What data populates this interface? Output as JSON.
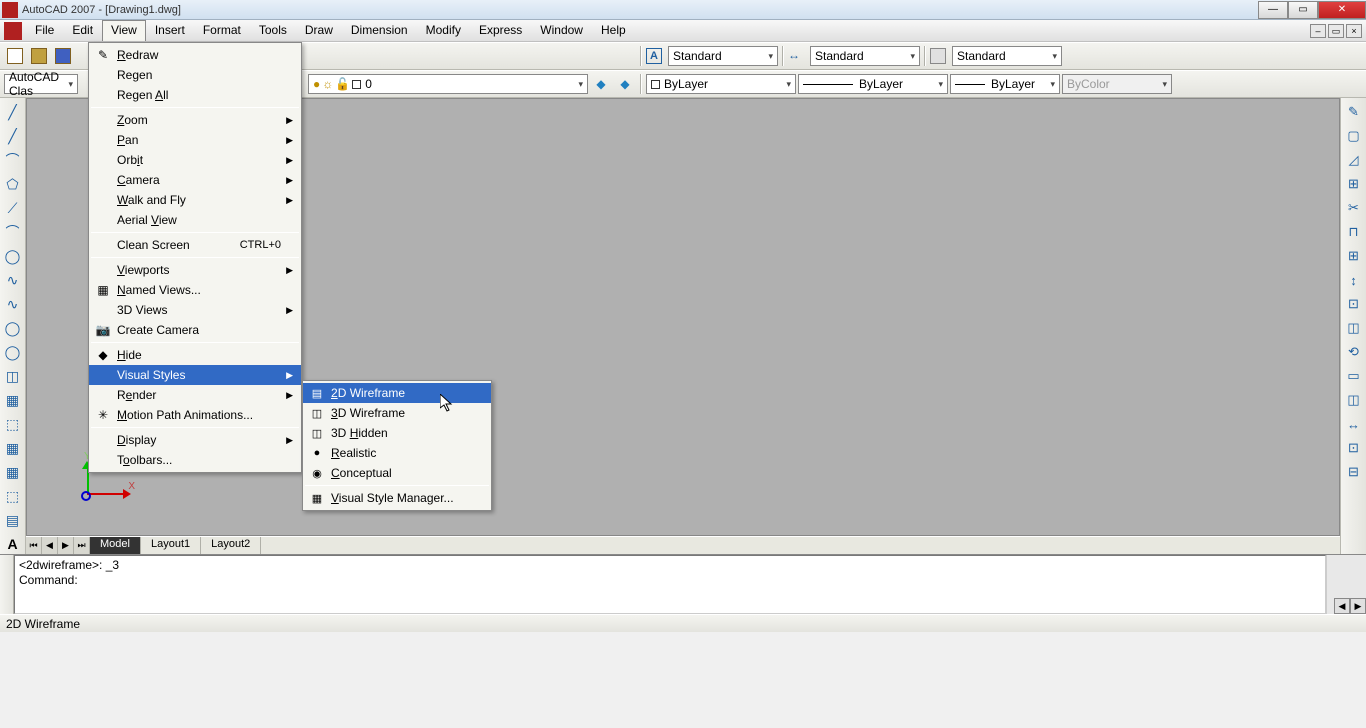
{
  "title": "AutoCAD 2007 - [Drawing1.dwg]",
  "menubar": [
    "File",
    "Edit",
    "View",
    "Insert",
    "Format",
    "Tools",
    "Draw",
    "Dimension",
    "Modify",
    "Express",
    "Window",
    "Help"
  ],
  "active_menu": "View",
  "toolbar1": {
    "workspace": "AutoCAD Clas",
    "std1": "Standard",
    "std2": "Standard",
    "std3": "Standard"
  },
  "toolbar2": {
    "layer_name": "0",
    "linetype1": "ByLayer",
    "linetype2": "ByLayer",
    "linetype3": "ByLayer",
    "color": "ByColor"
  },
  "view_menu": {
    "items": [
      {
        "label": "Redraw",
        "u": 0,
        "icon": "✎"
      },
      {
        "label": "Regen",
        "u": 2
      },
      {
        "label": "Regen All",
        "u": 6
      },
      {
        "sep": true
      },
      {
        "label": "Zoom",
        "u": 0,
        "sub": true
      },
      {
        "label": "Pan",
        "u": 0,
        "sub": true
      },
      {
        "label": "Orbit",
        "u": 3,
        "sub": true
      },
      {
        "label": "Camera",
        "u": 0,
        "sub": true
      },
      {
        "label": "Walk and Fly",
        "u": 0,
        "sub": true
      },
      {
        "label": "Aerial View",
        "u": 7
      },
      {
        "sep": true
      },
      {
        "label": "Clean Screen",
        "shortcut": "CTRL+0"
      },
      {
        "sep": true
      },
      {
        "label": "Viewports",
        "u": 0,
        "sub": true
      },
      {
        "label": "Named Views...",
        "u": 0,
        "icon": "▦"
      },
      {
        "label": "3D Views",
        "sub": true
      },
      {
        "label": "Create Camera",
        "icon": "📷"
      },
      {
        "sep": true
      },
      {
        "label": "Hide",
        "u": 0,
        "icon": "◆"
      },
      {
        "label": "Visual Styles",
        "sub": true,
        "highlight": true
      },
      {
        "label": "Render",
        "u": 1,
        "sub": true
      },
      {
        "label": "Motion Path Animations...",
        "u": 0,
        "icon": "✳"
      },
      {
        "sep": true
      },
      {
        "label": "Display",
        "u": 0,
        "sub": true
      },
      {
        "label": "Toolbars...",
        "u": 1
      }
    ]
  },
  "submenu": {
    "items": [
      {
        "label": "2D Wireframe",
        "u": 0,
        "icon": "▤",
        "highlight": true
      },
      {
        "label": "3D Wireframe",
        "u": 0,
        "icon": "◫"
      },
      {
        "label": "3D Hidden",
        "u": 3,
        "icon": "◫"
      },
      {
        "label": "Realistic",
        "u": 0,
        "icon": "●"
      },
      {
        "label": "Conceptual",
        "u": 0,
        "icon": "◉"
      },
      {
        "sep": true
      },
      {
        "label": "Visual Style Manager...",
        "u": 0,
        "icon": "▦"
      }
    ]
  },
  "tabs": {
    "active": "Model",
    "others": [
      "Layout1",
      "Layout2"
    ]
  },
  "command": {
    "line1": "<2dwireframe>: _3",
    "line2": "Command:"
  },
  "status": "2D Wireframe",
  "left_tools": [
    "╱",
    "╱",
    "⌒",
    "⟋",
    "⬠",
    "◯",
    "⌒",
    "◯",
    "∿",
    "◯",
    "◫",
    "▦",
    "⬚",
    "▦",
    "▤",
    "A"
  ],
  "right_tools": [
    "✎",
    "▢",
    "◿",
    "⊞",
    "✂",
    "⊓",
    "⊞",
    "↕",
    "⊡",
    "◫",
    "⟲",
    "▭",
    "◫",
    "↔",
    "⊡",
    "⊟",
    "⊞",
    "✚",
    "▭"
  ]
}
